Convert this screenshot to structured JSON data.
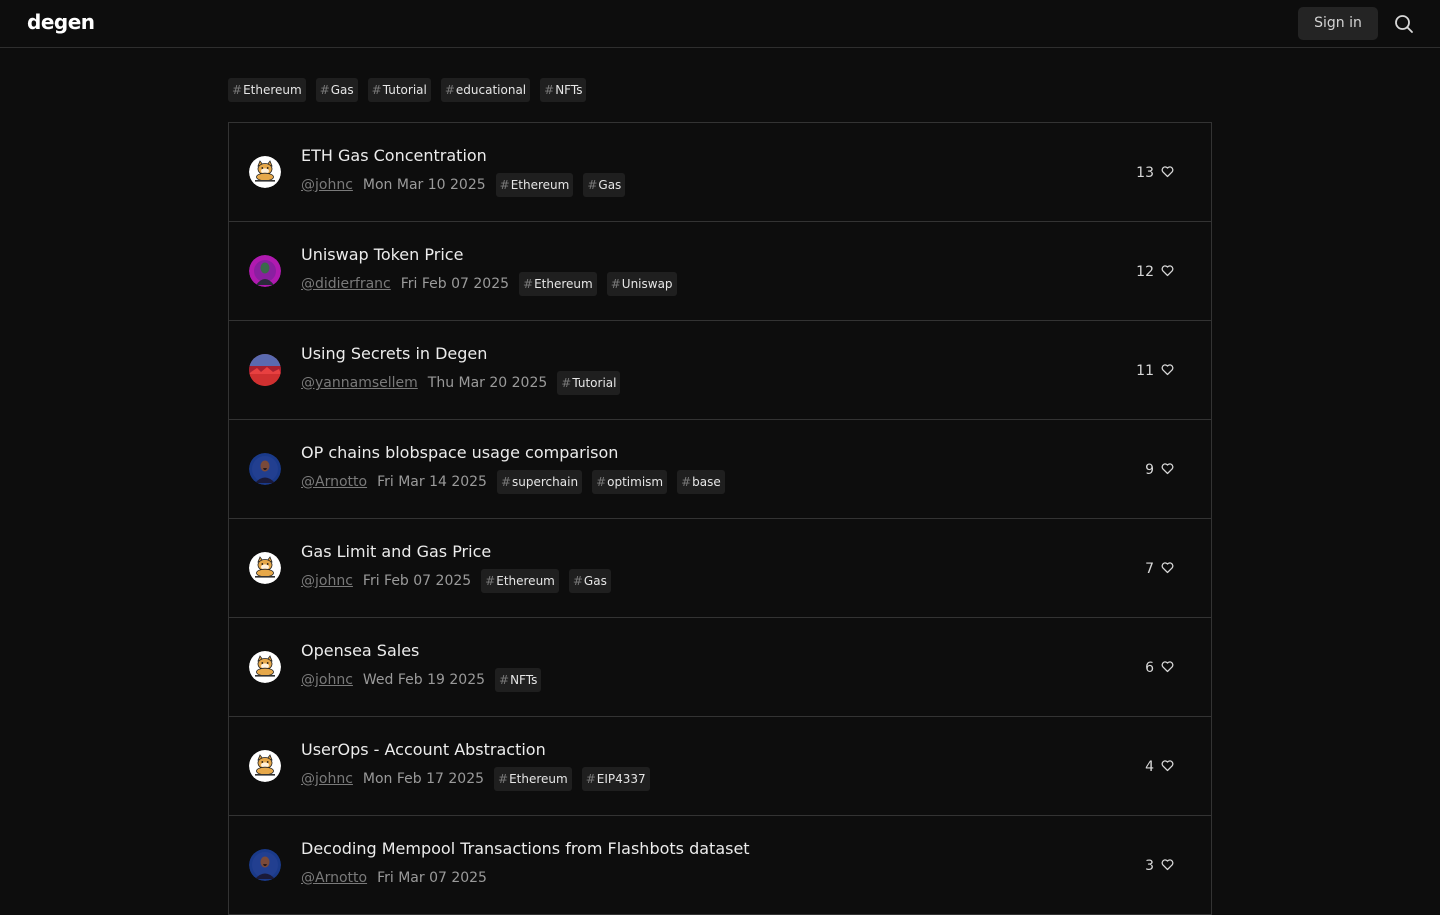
{
  "header": {
    "logo": "degen",
    "signin_label": "Sign in",
    "search_icon": "search-icon"
  },
  "filters": [
    {
      "hash": "#",
      "label": "Ethereum"
    },
    {
      "hash": "#",
      "label": "Gas"
    },
    {
      "hash": "#",
      "label": "Tutorial"
    },
    {
      "hash": "#",
      "label": "educational"
    },
    {
      "hash": "#",
      "label": "NFTs"
    }
  ],
  "posts": [
    {
      "title": "ETH Gas Concentration",
      "author": "@johnc",
      "date": "Mon Mar 10 2025",
      "likes": "13",
      "avatar": "shiba",
      "tags": [
        {
          "hash": "#",
          "label": "Ethereum"
        },
        {
          "hash": "#",
          "label": "Gas"
        }
      ]
    },
    {
      "title": "Uniswap Token Price",
      "author": "@didierfranc",
      "date": "Fri Feb 07 2025",
      "likes": "12",
      "avatar": "purple-person",
      "tags": [
        {
          "hash": "#",
          "label": "Ethereum"
        },
        {
          "hash": "#",
          "label": "Uniswap"
        }
      ]
    },
    {
      "title": "Using Secrets in Degen",
      "author": "@yannamsellem",
      "date": "Thu Mar 20 2025",
      "likes": "11",
      "avatar": "red-landscape",
      "tags": [
        {
          "hash": "#",
          "label": "Tutorial"
        }
      ]
    },
    {
      "title": "OP chains blobspace usage comparison",
      "author": "@Arnotto",
      "date": "Fri Mar 14 2025",
      "likes": "9",
      "avatar": "blue-person",
      "tags": [
        {
          "hash": "#",
          "label": "superchain"
        },
        {
          "hash": "#",
          "label": "optimism"
        },
        {
          "hash": "#",
          "label": "base"
        }
      ]
    },
    {
      "title": "Gas Limit and Gas Price",
      "author": "@johnc",
      "date": "Fri Feb 07 2025",
      "likes": "7",
      "avatar": "shiba",
      "tags": [
        {
          "hash": "#",
          "label": "Ethereum"
        },
        {
          "hash": "#",
          "label": "Gas"
        }
      ]
    },
    {
      "title": "Opensea Sales",
      "author": "@johnc",
      "date": "Wed Feb 19 2025",
      "likes": "6",
      "avatar": "shiba",
      "tags": [
        {
          "hash": "#",
          "label": "NFTs"
        }
      ]
    },
    {
      "title": "UserOps - Account Abstraction",
      "author": "@johnc",
      "date": "Mon Feb 17 2025",
      "likes": "4",
      "avatar": "shiba",
      "tags": [
        {
          "hash": "#",
          "label": "Ethereum"
        },
        {
          "hash": "#",
          "label": "EIP4337"
        }
      ]
    },
    {
      "title": "Decoding Mempool Transactions from Flashbots dataset",
      "author": "@Arnotto",
      "date": "Fri Mar 07 2025",
      "likes": "3",
      "avatar": "blue-person",
      "tags": []
    }
  ],
  "colors": {
    "background": "#0d0d0d",
    "tag_background": "#1f1f1f",
    "border": "#333333",
    "muted_text": "#7a7a7a"
  }
}
